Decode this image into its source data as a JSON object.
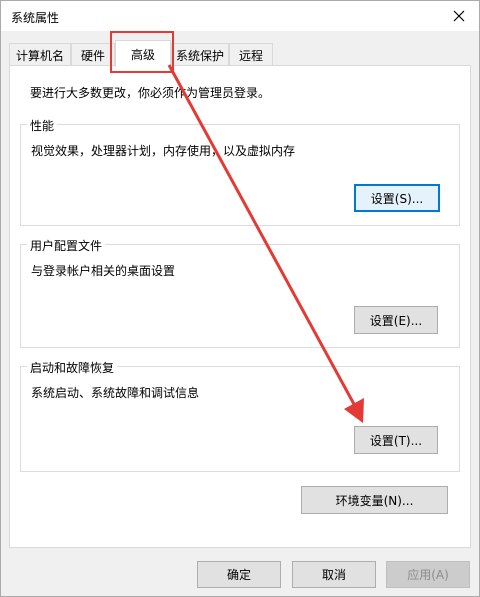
{
  "window": {
    "title": "系统属性"
  },
  "tabs": [
    {
      "label": "计算机名",
      "active": false
    },
    {
      "label": "硬件",
      "active": false
    },
    {
      "label": "高级",
      "active": true
    },
    {
      "label": "系统保护",
      "active": false
    },
    {
      "label": "远程",
      "active": false
    }
  ],
  "panel": {
    "admin_note": "要进行大多数更改，你必须作为管理员登录。",
    "performance": {
      "title": "性能",
      "desc": "视觉效果，处理器计划，内存使用，以及虚拟内存",
      "button": "设置(S)..."
    },
    "user_profiles": {
      "title": "用户配置文件",
      "desc": "与登录帐户相关的桌面设置",
      "button": "设置(E)..."
    },
    "startup_recovery": {
      "title": "启动和故障恢复",
      "desc": "系统启动、系统故障和调试信息",
      "button": "设置(T)..."
    },
    "env_button": "环境变量(N)..."
  },
  "footer": {
    "ok": "确定",
    "cancel": "取消",
    "apply": "应用(A)"
  },
  "colors": {
    "annotation_red": "#e53935",
    "focus_blue": "#0078d7"
  }
}
